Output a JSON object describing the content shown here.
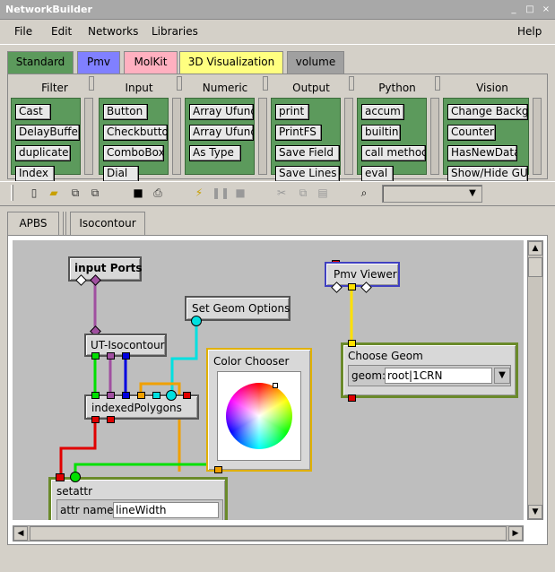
{
  "window": {
    "title": "NetworkBuilder"
  },
  "menu": {
    "file": "File",
    "edit": "Edit",
    "networks": "Networks",
    "libraries": "Libraries",
    "help": "Help"
  },
  "library_tabs": [
    {
      "label": "Standard",
      "color": "#5c9a5c"
    },
    {
      "label": "Pmv",
      "color": "#8080ff"
    },
    {
      "label": "MolKit",
      "color": "#ffb0c0"
    },
    {
      "label": "3D Visualization",
      "color": "#ffff80"
    },
    {
      "label": "volume",
      "color": "#a0a0a0"
    }
  ],
  "categories": [
    {
      "name": "Filter",
      "nodes": [
        "Cast",
        "DelayBuffer",
        "duplicate",
        "Index"
      ]
    },
    {
      "name": "Input",
      "nodes": [
        "Button",
        "Checkbutto",
        "ComboBox",
        "Dial"
      ]
    },
    {
      "name": "Numeric",
      "nodes": [
        "Array Ufunc",
        "Array Ufunc",
        "As Type"
      ]
    },
    {
      "name": "Output",
      "nodes": [
        "print",
        "PrintFS",
        "Save Field",
        "Save Lines"
      ]
    },
    {
      "name": "Python",
      "nodes": [
        "accum",
        "builtin",
        "call method",
        "eval"
      ]
    },
    {
      "name": "Vision",
      "nodes": [
        "Change Backg",
        "Counter",
        "HasNewData",
        "Show/Hide GU"
      ]
    }
  ],
  "network_tabs": [
    "APBS",
    "Isocontour"
  ],
  "nodes": {
    "input_ports": "input Ports",
    "ut_isocontour": "UT-Isocontour",
    "indexed_polygons": "indexedPolygons",
    "set_geom_options": "Set Geom Options",
    "color_chooser": "Color Chooser",
    "pmv_viewer": "Pmv Viewer",
    "choose_geom": "Choose Geom",
    "choose_geom_label": "geom:",
    "choose_geom_value": "root|1CRN",
    "setattr": "setattr",
    "attr_name_label": "attr name:",
    "attr_name_value": "lineWidth"
  }
}
